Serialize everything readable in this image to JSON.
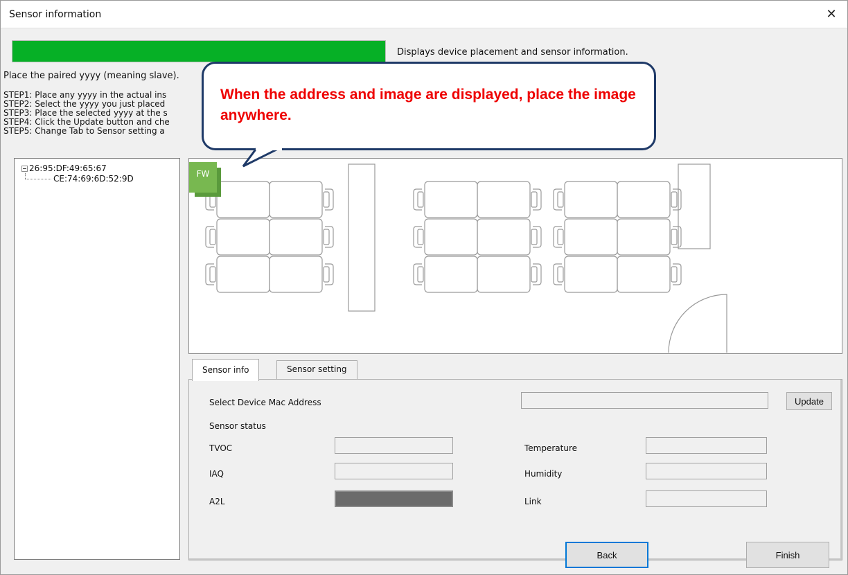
{
  "window": {
    "title": "Sensor information",
    "close_symbol": "✕"
  },
  "progress": {
    "fraction": 1.0,
    "color": "#06b026"
  },
  "description": "Displays device placement and sensor information.",
  "instruction": "Place the paired yyyy (meaning slave).",
  "steps": [
    "STEP1: Place any yyyy in the actual ins",
    "STEP2: Select the yyyy you just placed",
    "STEP3: Place the selected yyyy at the s",
    "STEP4: Click the Update button and che",
    "STEP5: Change Tab to Sensor setting a"
  ],
  "tree": {
    "root": "26:95:DF:49:65:67",
    "child": "CE:74:69:6D:52:9D"
  },
  "sensor_chip": {
    "label": "FW"
  },
  "callout": {
    "text": "When the address and image are displayed, place the image anywhere.",
    "color": "#ee0000"
  },
  "tabs": {
    "active": "Sensor info",
    "inactive": "Sensor setting"
  },
  "panel": {
    "select_mac_label": "Select Device Mac Address",
    "update_label": "Update",
    "sensor_status_label": "Sensor status",
    "tvoc": "TVOC",
    "iaq": "IAQ",
    "a2l": "A2L",
    "temperature": "Temperature",
    "humidity": "Humidity",
    "link": "Link"
  },
  "footer": {
    "back_label": "Back",
    "finish_label": "Finish"
  },
  "icons": [
    "close-icon",
    "tree-collapse-icon",
    "sensor-device-icon",
    "floor-plan"
  ]
}
